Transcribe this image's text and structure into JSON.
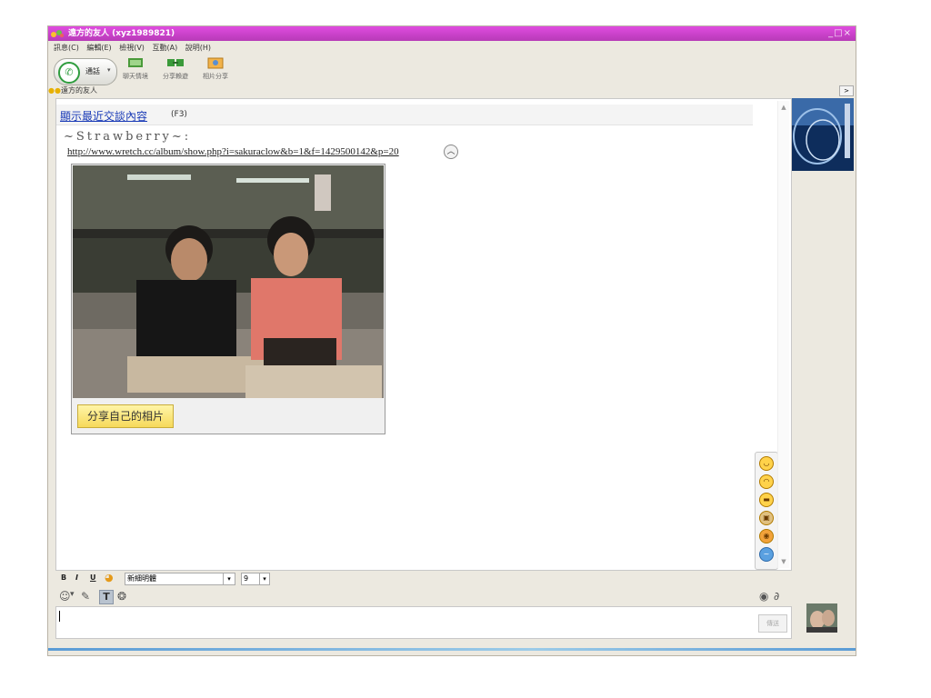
{
  "window": {
    "title": "遠方的友人 (xyz1989821)",
    "controls": "_□×"
  },
  "menu": [
    "訊息(C)",
    "編輯(E)",
    "檢視(V)",
    "互動(A)",
    "說明(H)"
  ],
  "toolbar": {
    "call_label": "通話",
    "tools": [
      {
        "label": "聊天情境",
        "icon": "chat-scene-icon"
      },
      {
        "label": "分享賴遊",
        "icon": "share-game-icon"
      },
      {
        "label": "相片分享",
        "icon": "photo-share-icon"
      }
    ]
  },
  "contact": {
    "name": "遠方的友人",
    "expand": ">"
  },
  "chat": {
    "history_link": "顯示最近交談內容",
    "history_key": "(F3)",
    "sender": "~Strawberry~:",
    "url": "http://www.wretch.cc/album/show.php?i=sakuraclow&b=1&f=1429500142&p=20",
    "share_button": "分享自己的相片"
  },
  "emoticons": [
    "smile-emo",
    "grin-emo",
    "cool-emo",
    "gift-emo",
    "camera-emo",
    "info-emo"
  ],
  "format": {
    "bold": "B",
    "italic": "I",
    "underline": "U",
    "font": "新細明體",
    "size": "9"
  },
  "input": {
    "send_label": "傳送"
  },
  "colors": {
    "titlebar": "#c842c8",
    "link": "#1a3bb7",
    "share_button": "#f6d95a"
  }
}
